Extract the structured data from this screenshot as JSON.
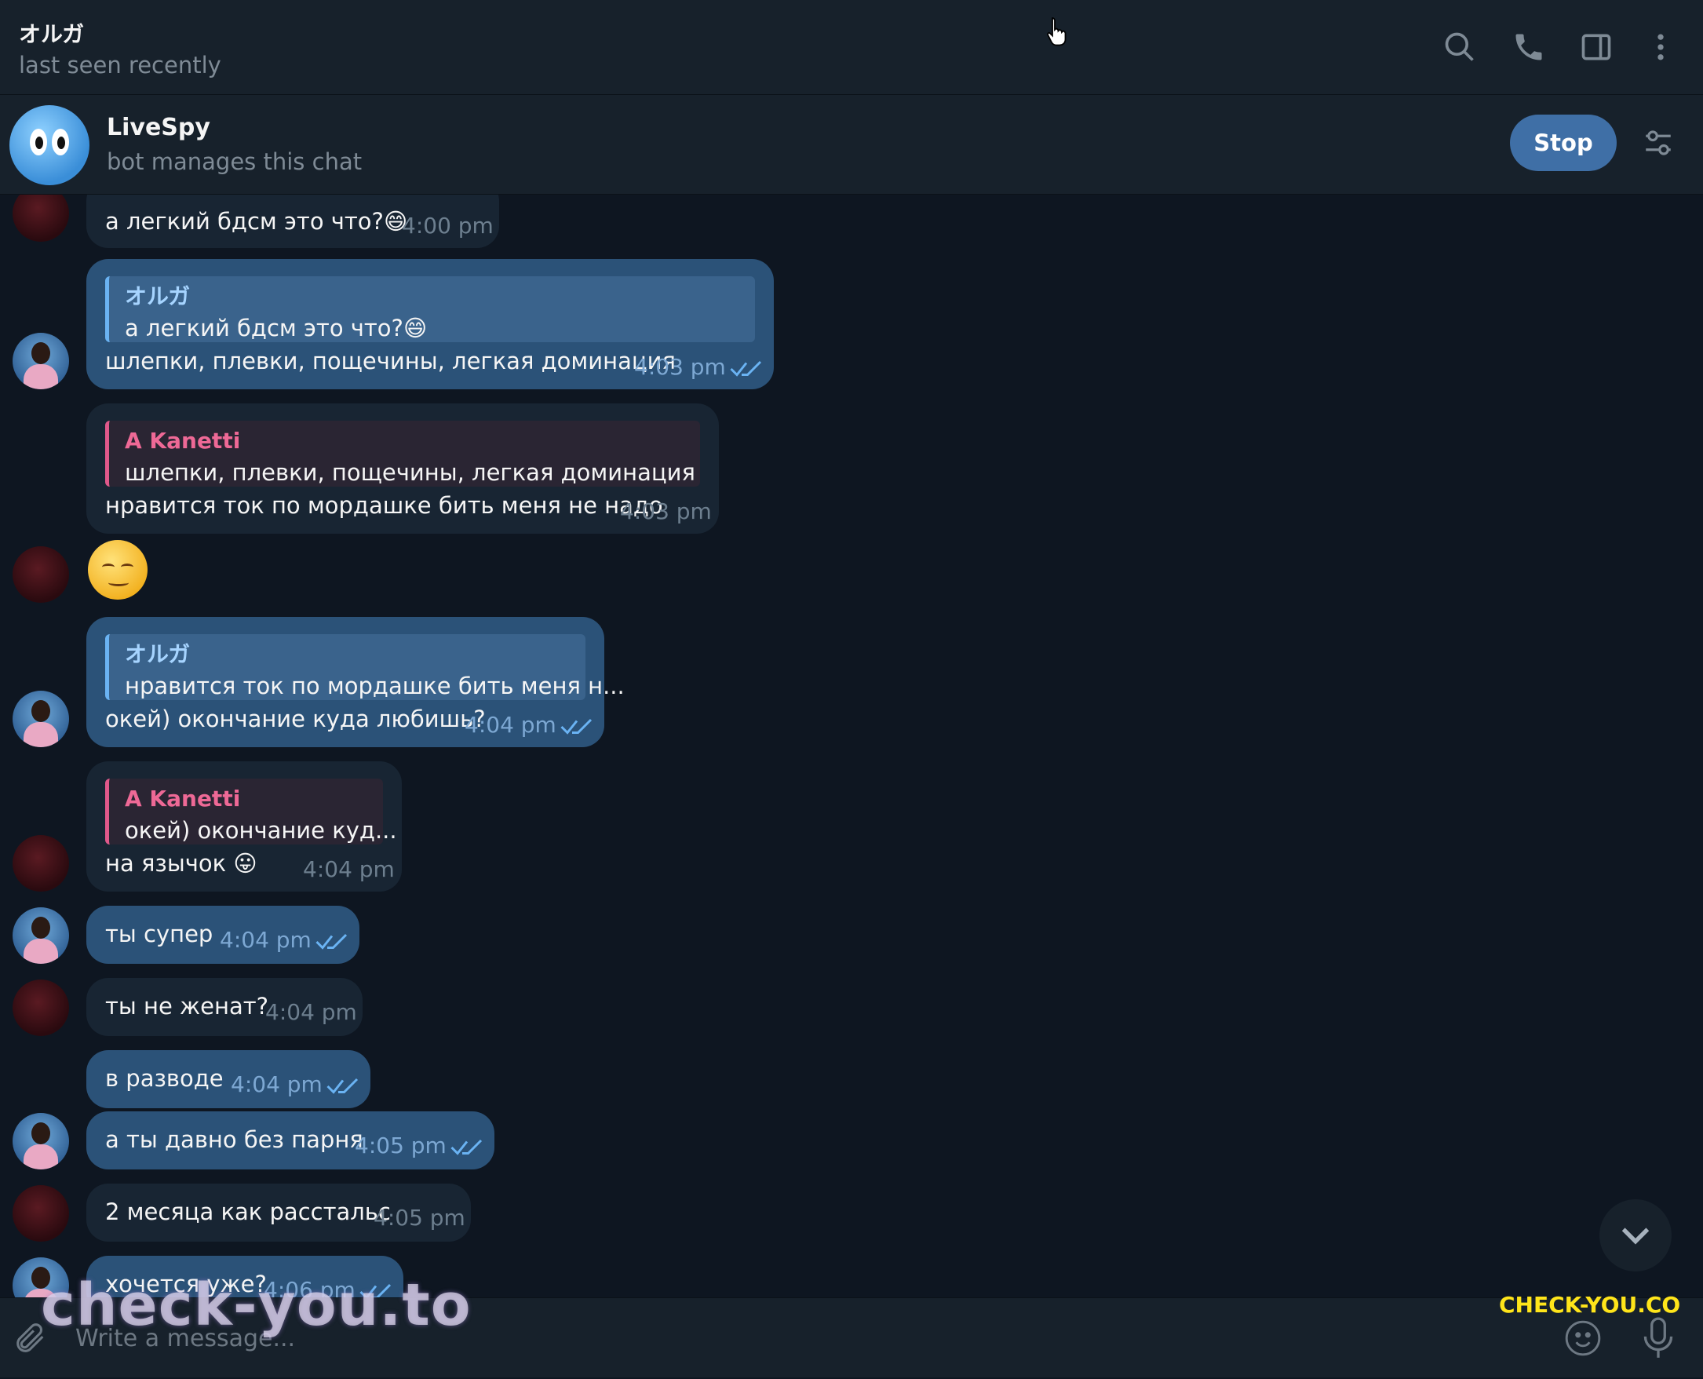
{
  "header": {
    "title": "オルガ",
    "status": "last seen recently",
    "icons": [
      "search-icon",
      "phone-icon",
      "sidebar-toggle-icon",
      "more-vertical-icon"
    ]
  },
  "bot_bar": {
    "name": "LiveSpy",
    "subtitle": "bot manages this chat",
    "stop_label": "Stop"
  },
  "messages": [
    {
      "from": "A Kanetti",
      "text": "а легкий бдсм это что?😄",
      "time": "4:00 pm"
    },
    {
      "from": "me",
      "reply_name": "オルガ",
      "reply_text": "а легкий бдсм это что?😄",
      "text": "шлепки, плевки, пощечины, легкая доминация",
      "time": "4:03 pm"
    },
    {
      "from": "A Kanetti",
      "reply_name": "A Kanetti",
      "reply_text": "шлепки, плевки, пощечины, легкая доминация",
      "text": "нравится ток по мордашке бить меня не надо",
      "time": "4:03 pm"
    },
    {
      "from": "A Kanetti",
      "sticker": "relieved-face-emoji"
    },
    {
      "from": "me",
      "reply_name": "オルガ",
      "reply_text": "нравится ток по мордашке бить меня н...",
      "text": "окей) окончание куда любишь?",
      "time": "4:04 pm"
    },
    {
      "from": "A Kanetti",
      "reply_name": "A Kanetti",
      "reply_text": "окей) окончание куд...",
      "text": "на язычок 😛",
      "time": "4:04 pm"
    },
    {
      "from": "me",
      "text": "ты супер",
      "time": "4:04 pm"
    },
    {
      "from": "A Kanetti",
      "text": "ты не женат?",
      "time": "4:04 pm"
    },
    {
      "from": "me",
      "text": "в разводе",
      "time": "4:04 pm"
    },
    {
      "from": "me",
      "text": "а ты давно без парня",
      "time": "4:05 pm"
    },
    {
      "from": "A Kanetti",
      "text": "2 месяца как расстальс",
      "time": "4:05 pm"
    },
    {
      "from": "me",
      "text": "хочется уже?",
      "time": "4:06 pm"
    }
  ],
  "composer": {
    "placeholder": "Write a message..."
  },
  "watermarks": {
    "left": "check-you.to",
    "right": "CHECK-YOU.CO"
  },
  "colors": {
    "background": "#0e1621",
    "panel": "#17212b",
    "outgoing_bubble": "#2b5278",
    "incoming_bubble": "#182533",
    "accent": "#6ab3f3",
    "reply_name_incoming": "#ee6996",
    "stop_button": "#3f6fa6"
  }
}
